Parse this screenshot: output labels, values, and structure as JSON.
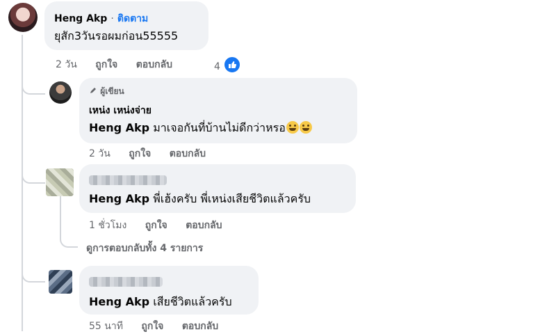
{
  "colors": {
    "bubble": "#f0f2f5",
    "link": "#1877f2",
    "meta": "#65676b",
    "line": "#d3d6db",
    "like": "#1877f2"
  },
  "top_comment": {
    "author": "Heng Akp",
    "separator": "·",
    "follow": "ติดตาม",
    "text": "ยุสัก3วันรอผมก่อน55555",
    "time": "2 วัน",
    "like": "ถูกใจ",
    "reply": "ตอบกลับ",
    "reaction_count": "4",
    "reaction_icon": "thumbs-up-icon"
  },
  "replies": [
    {
      "badge": "ผู้เขียน",
      "badge_icon": "pencil-icon",
      "author": "เหน่ง เหน่งจ่าย",
      "mention": "Heng Akp",
      "text": " มาเจอกันที่บ้านไม่ดีกว่าหรอ",
      "emoji": "grinning-emoji",
      "time": "2 วัน",
      "like": "ถูกใจ",
      "reply": "ตอบกลับ"
    },
    {
      "mention": "Heng Akp",
      "text": " พี่เฮ้งครับ พี่เหน่งเสียชีวิตแล้วครับ",
      "time": "1 ชั่วโมง",
      "like": "ถูกใจ",
      "reply": "ตอบกลับ",
      "view_more": "ดูการตอบกลับทั้ง 4 รายการ"
    },
    {
      "mention": "Heng Akp",
      "text": " เสียชีวิตแล้วครับ",
      "time": "55 นาที",
      "like": "ถูกใจ",
      "reply": "ตอบกลับ"
    }
  ]
}
